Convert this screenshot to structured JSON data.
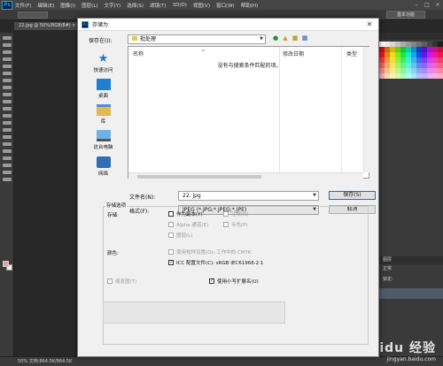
{
  "app": {
    "logo": "Ps",
    "menu": [
      "文件(F)",
      "编辑(E)",
      "图像(I)",
      "图层(L)",
      "文字(Y)",
      "选择(S)",
      "滤镜(T)",
      "3D(D)",
      "视图(V)",
      "窗口(W)",
      "帮助(H)"
    ],
    "workspace": "基本功能",
    "doc_tab": "22.jpg @ 50%(RGB/8#) ×",
    "status": "50%   文档:864.5K/864.5K",
    "layers_label": "图层",
    "layers_mode": "正常",
    "layer_lock": "锁定:"
  },
  "dialog": {
    "title": "存储为",
    "save_in_label": "保存在(I):",
    "save_in_value": "批处理",
    "places": [
      {
        "label": "快速访问"
      },
      {
        "label": "桌面"
      },
      {
        "label": "库"
      },
      {
        "label": "这台电脑"
      },
      {
        "label": "网络"
      }
    ],
    "columns": {
      "name": "名称",
      "date": "修改日期",
      "type": "类型"
    },
    "empty_text": "没有与搜索条件匹配的项。",
    "filename_label": "文件名(N):",
    "filename_value": "22. jpg",
    "format_label": "格式(F):",
    "format_value": "JPEG (*.JPG;*.JPEG;*.JPE)",
    "save_button": "保存(S)",
    "cancel_button": "取消",
    "options_title": "存储选项",
    "store_label": "存储:",
    "as_copy": "作为副本(Y)",
    "annotations": "注释(N)",
    "alpha": "Alpha 通道(E)",
    "spot": "专色(P)",
    "layers": "图层(L)",
    "color_label": "颜色:",
    "use_proof": "使用校样设置(O): 工作中的 CMYK",
    "icc": "ICC 配置文件(C): sRGB IEC61966-2.1",
    "thumbnail": "缩览图(T)",
    "lowercase": "使用小写扩展名(U)"
  },
  "watermark": {
    "brand": "Baidu 经验",
    "url": "jingyan.baidu.com"
  }
}
